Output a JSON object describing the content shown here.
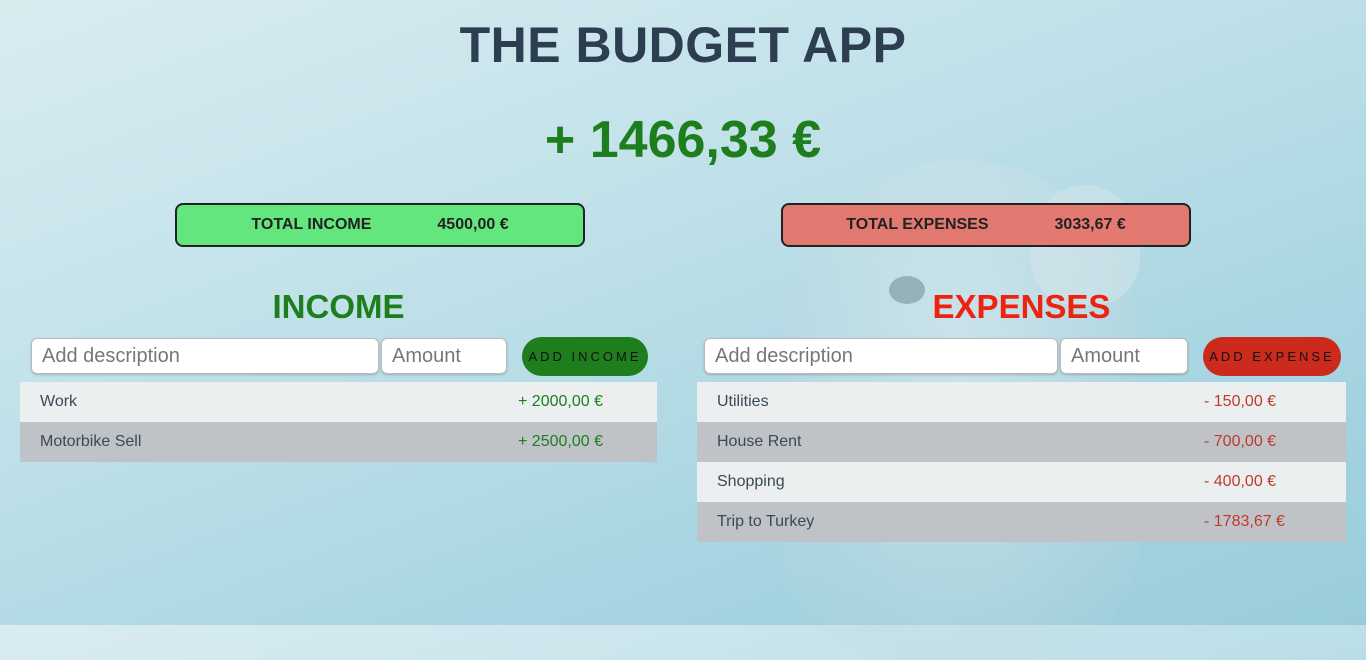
{
  "app": {
    "title": "THE BUDGET APP",
    "balance": "+ 1466,33 €"
  },
  "totals": {
    "income_label": "TOTAL INCOME",
    "income_value": "4500,00 €",
    "expenses_label": "TOTAL EXPENSES",
    "expenses_value": "3033,67 €"
  },
  "income": {
    "title": "INCOME",
    "description_placeholder": "Add description",
    "amount_placeholder": "Amount",
    "add_button": "ADD INCOME",
    "items": [
      {
        "description": "Work",
        "value": "+ 2000,00 €"
      },
      {
        "description": "Motorbike Sell",
        "value": "+ 2500,00 €"
      }
    ]
  },
  "expenses": {
    "title": "EXPENSES",
    "description_placeholder": "Add description",
    "amount_placeholder": "Amount",
    "add_button": "ADD EXPENSE",
    "items": [
      {
        "description": "Utilities",
        "value": "- 150,00 €"
      },
      {
        "description": "House Rent",
        "value": "- 700,00 €"
      },
      {
        "description": "Shopping",
        "value": "- 400,00 €"
      },
      {
        "description": "Trip to Turkey",
        "value": "- 1783,67 €"
      }
    ]
  },
  "colors": {
    "income": "#1e7e1e",
    "expense": "#cc2a1c",
    "title": "#2c3e50"
  }
}
